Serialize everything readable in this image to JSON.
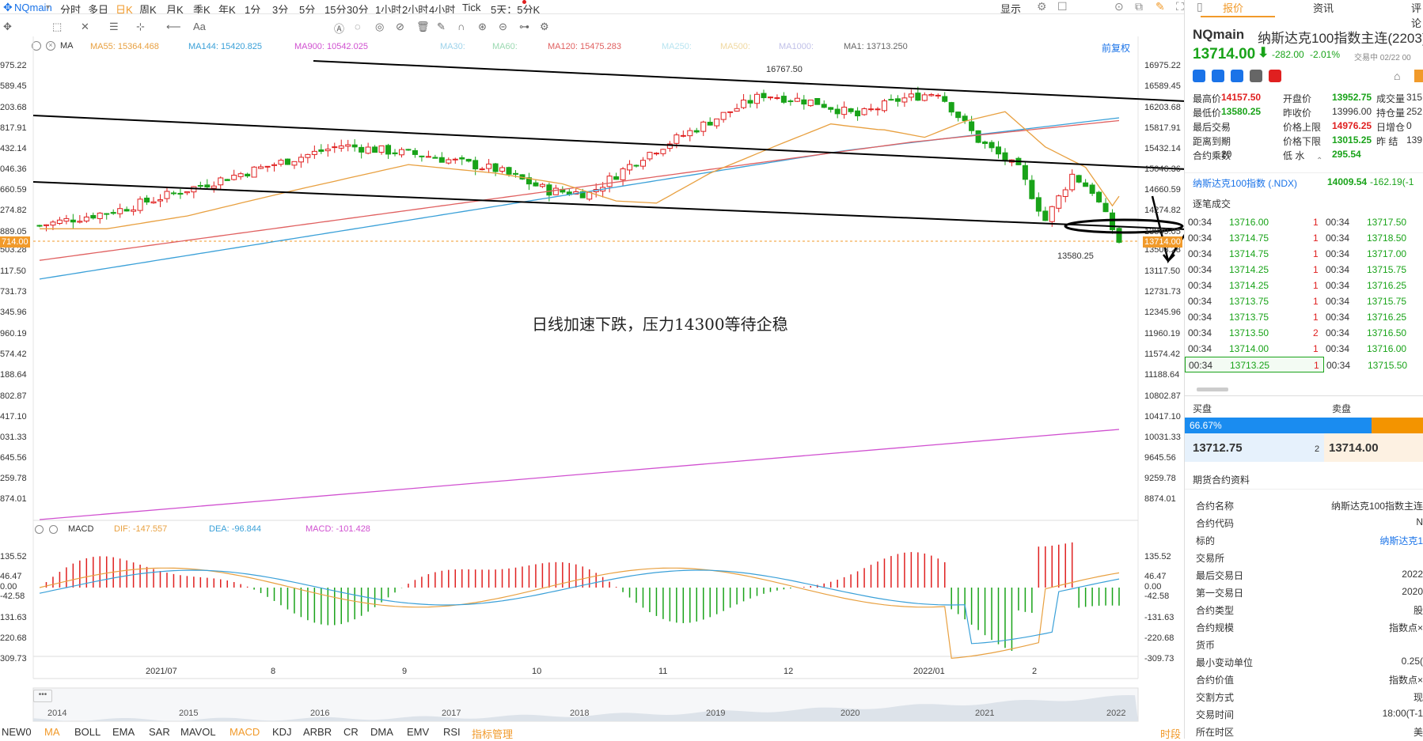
{
  "toolbar": {
    "symbol": "NQmain",
    "periods": [
      "分时",
      "多日",
      "日K",
      "周K",
      "月K",
      "季K",
      "年K",
      "1分",
      "3分",
      "5分",
      "15分",
      "30分",
      "1小时",
      "2小时",
      "4小时",
      "Tick",
      "5天：5分K"
    ],
    "active": "日K",
    "display": "显示",
    "text_tool": "Aa"
  },
  "indicators": {
    "ma_label": "MA",
    "ma55": "MA55: 15364.468",
    "ma144": "MA144: 15420.825",
    "ma900": "MA900: 10542.025",
    "ma30": "MA30:",
    "ma60": "MA60:",
    "ma120": "MA120: 15475.283",
    "ma250": "MA250:",
    "ma500": "MA500:",
    "ma1000": "MA1000:",
    "ma1": "MA1: 13713.250",
    "adjust": "前复权"
  },
  "price_axis": {
    "left": [
      "975.22",
      "589.45",
      "203.68",
      "817.91",
      "432.14",
      "046.36",
      "660.59",
      "274.82",
      "889.05",
      "503.28",
      "117.50",
      "731.73",
      "345.96",
      "960.19",
      "574.42",
      "188.64",
      "802.87",
      "417.10",
      "031.33",
      "645.56",
      "259.78",
      "874.01"
    ],
    "right": [
      "16975.22",
      "16589.45",
      "16203.68",
      "15817.91",
      "15432.14",
      "15046.36",
      "14660.59",
      "14274.82",
      "13889.05",
      "13503.28",
      "13117.50",
      "12731.73",
      "12345.96",
      "11960.19",
      "11574.42",
      "11188.64",
      "10802.87",
      "10417.10",
      "10031.33",
      "9645.56",
      "9259.78",
      "8874.01"
    ],
    "current_left": "714.00",
    "current_right": "13714.00"
  },
  "chart_annotations": {
    "high": "16767.50",
    "low": "13580.25",
    "comment": "日线加速下跌，压力14300等待企稳"
  },
  "macd": {
    "label": "MACD",
    "dif": "DIF: -147.557",
    "dea": "DEA: -96.844",
    "macd": "MACD: -101.428",
    "left_ticks": [
      "135.52",
      "46.47",
      "0.00",
      "-42.58",
      "131.63",
      "220.68",
      "309.73"
    ],
    "right_ticks": [
      "135.52",
      "46.47",
      "0.00",
      "-42.58",
      "-131.63",
      "-220.68",
      "-309.73"
    ]
  },
  "date_axis": [
    "2021/07",
    "8",
    "9",
    "10",
    "11",
    "12",
    "2022/01",
    "2"
  ],
  "overview_years": [
    "2014",
    "2015",
    "2016",
    "2017",
    "2018",
    "2019",
    "2020",
    "2021",
    "2022"
  ],
  "bottom_tabs": [
    "NEW0",
    "MA",
    "BOLL",
    "EMA",
    "SAR",
    "MAVOL",
    "MACD",
    "KDJ",
    "ARBR",
    "CR",
    "DMA",
    "EMV",
    "RSI",
    "指标管理"
  ],
  "bottom_active": [
    "MA",
    "MACD"
  ],
  "bottom_right": "时段",
  "right_panel": {
    "tabs": [
      "报价",
      "资讯",
      "评论"
    ],
    "title": "NQmain",
    "name": "纳斯达克100指数主连(2203)",
    "price": "13714.00",
    "change": "-282.00",
    "pct": "-2.01%",
    "status": "交易中 02/22 00",
    "quote_rows": [
      [
        {
          "k": "最高价",
          "v": "14157.50",
          "c": "red"
        },
        {
          "k": "开盘价",
          "v": "13952.75",
          "c": "green"
        },
        {
          "k": "成交量",
          "v": "315",
          "c": ""
        }
      ],
      [
        {
          "k": "最低价",
          "v": "13580.25",
          "c": "green"
        },
        {
          "k": "昨收价",
          "v": "13996.00",
          "c": ""
        },
        {
          "k": "持仓量",
          "v": "252",
          "c": ""
        }
      ],
      [
        {
          "k": "最后交易",
          "v": "--",
          "c": ""
        },
        {
          "k": "价格上限",
          "v": "14976.25",
          "c": "red"
        },
        {
          "k": "日增仓",
          "v": "0",
          "c": ""
        }
      ],
      [
        {
          "k": "距离到期",
          "v": "--",
          "c": ""
        },
        {
          "k": "价格下限",
          "v": "13015.25",
          "c": "green"
        },
        {
          "k": "昨 结",
          "v": "139",
          "c": ""
        }
      ],
      [
        {
          "k": "合约乘数",
          "v": "20",
          "c": ""
        },
        {
          "k": "低 水",
          "v": "295.54",
          "c": "green"
        },
        {
          "k": "",
          "v": "",
          "c": ""
        }
      ]
    ],
    "index_name": "纳斯达克100指数 (.NDX)",
    "index_price": "14009.54",
    "index_change": "-162.19(-1",
    "ticks_title": "逐笔成交",
    "ticks": [
      [
        "00:34",
        "13716.00",
        "1",
        "00:34",
        "13717.50"
      ],
      [
        "00:34",
        "13714.75",
        "1",
        "00:34",
        "13718.50"
      ],
      [
        "00:34",
        "13714.75",
        "1",
        "00:34",
        "13717.00"
      ],
      [
        "00:34",
        "13714.25",
        "1",
        "00:34",
        "13715.75"
      ],
      [
        "00:34",
        "13714.25",
        "1",
        "00:34",
        "13716.25"
      ],
      [
        "00:34",
        "13713.75",
        "1",
        "00:34",
        "13715.75"
      ],
      [
        "00:34",
        "13713.75",
        "1",
        "00:34",
        "13716.25"
      ],
      [
        "00:34",
        "13713.50",
        "2",
        "00:34",
        "13716.50"
      ],
      [
        "00:34",
        "13714.00",
        "1",
        "00:34",
        "13716.00"
      ],
      [
        "00:34",
        "13713.25",
        "1",
        "00:34",
        "13715.50"
      ]
    ],
    "buy_label": "买盘",
    "sell_label": "卖盘",
    "buy_pct": "66.67%",
    "bid": "13712.75",
    "bid_qty": "2",
    "ask": "13714.00",
    "contract_title": "期货合约资料",
    "contract": [
      {
        "k": "合约名称",
        "v": "纳斯达克100指数主连"
      },
      {
        "k": "合约代码",
        "v": "N"
      },
      {
        "k": "标的",
        "v": "纳斯达克1"
      },
      {
        "k": "交易所",
        "v": ""
      },
      {
        "k": "最后交易日",
        "v": "2022"
      },
      {
        "k": "第一交易日",
        "v": "2020"
      },
      {
        "k": "合约类型",
        "v": "股"
      },
      {
        "k": "合约规模",
        "v": "指数点×"
      },
      {
        "k": "货币",
        "v": ""
      },
      {
        "k": "最小变动单位",
        "v": "0.25("
      },
      {
        "k": "合约价值",
        "v": "指数点×"
      },
      {
        "k": "交割方式",
        "v": "现"
      },
      {
        "k": "交易时间",
        "v": "18:00(T-1"
      },
      {
        "k": "所在时区",
        "v": "美"
      }
    ]
  },
  "colors": {
    "up": "#e02020",
    "down": "#19a319",
    "accent": "#f19a2a",
    "ma55": "#e8a040",
    "ma144": "#3aa0d8",
    "ma900": "#d050d0",
    "ma120": "#e06060",
    "dif": "#e8a040",
    "dea": "#3aa0d8"
  }
}
